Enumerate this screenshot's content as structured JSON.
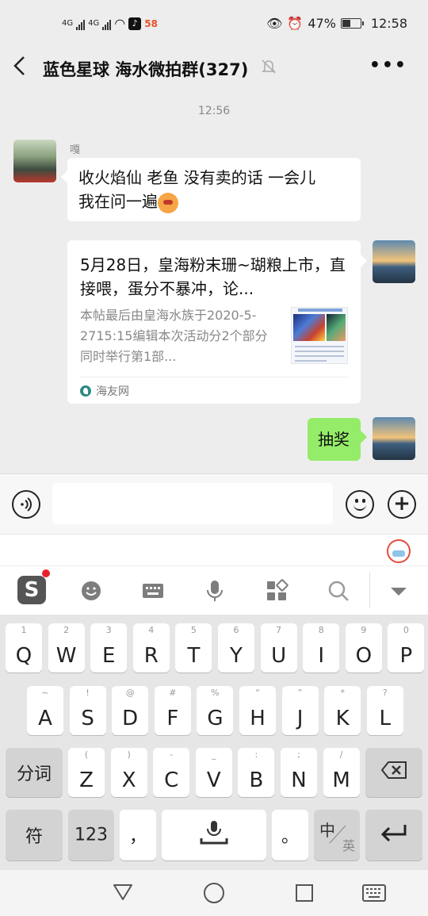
{
  "status_bar": {
    "signal1": "4G",
    "signal2": "4G",
    "app_badge": "58",
    "battery": "47%",
    "battery_level": 0.47,
    "time": "12:58"
  },
  "header": {
    "title": "蓝色星球 海水微拍群(327)",
    "more": "•••"
  },
  "chat": {
    "timestamp": "12:56",
    "messages": [
      {
        "sender": "嘎",
        "text_line1": "收火焰仙 老鱼 没有卖的话 一会儿",
        "text_line2": "我在问一遍"
      },
      {
        "type": "link_card",
        "title": "5月28日，皇海粉末珊~瑚粮上市，直接喂，蛋分不暴冲，论...",
        "desc": "本帖最后由皇海水族于2020-5-2715:15编辑本次活动分2个部分同时举行第1部...",
        "source": "海友网"
      },
      {
        "type": "text_mine",
        "text": "抽奖"
      }
    ]
  },
  "input_bar": {
    "placeholder": ""
  },
  "keyboard": {
    "row1": [
      {
        "k": "Q",
        "s": "1"
      },
      {
        "k": "W",
        "s": "2"
      },
      {
        "k": "E",
        "s": "3"
      },
      {
        "k": "R",
        "s": "4"
      },
      {
        "k": "T",
        "s": "5"
      },
      {
        "k": "Y",
        "s": "6"
      },
      {
        "k": "U",
        "s": "7"
      },
      {
        "k": "I",
        "s": "8"
      },
      {
        "k": "O",
        "s": "9"
      },
      {
        "k": "P",
        "s": "0"
      }
    ],
    "row2": [
      {
        "k": "A",
        "s": "~"
      },
      {
        "k": "S",
        "s": "!"
      },
      {
        "k": "D",
        "s": "@"
      },
      {
        "k": "F",
        "s": "#"
      },
      {
        "k": "G",
        "s": "%"
      },
      {
        "k": "H",
        "s": "“"
      },
      {
        "k": "J",
        "s": "”"
      },
      {
        "k": "K",
        "s": "*"
      },
      {
        "k": "L",
        "s": "?"
      }
    ],
    "row3": [
      {
        "k": "Z",
        "s": "("
      },
      {
        "k": "X",
        "s": ")"
      },
      {
        "k": "C",
        "s": "-"
      },
      {
        "k": "V",
        "s": "_"
      },
      {
        "k": "B",
        "s": ":"
      },
      {
        "k": "N",
        "s": ";"
      },
      {
        "k": "M",
        "s": "/"
      }
    ],
    "fenci": "分词",
    "fu": "符",
    "num": "123",
    "comma": "，",
    "period": "。",
    "zh": "中",
    "en": "英"
  },
  "icons": {
    "back": "chevron-left-icon",
    "mute": "bell-off-icon",
    "voice": "voice-icon",
    "emoji": "smile-icon",
    "plus": "plus-icon"
  }
}
